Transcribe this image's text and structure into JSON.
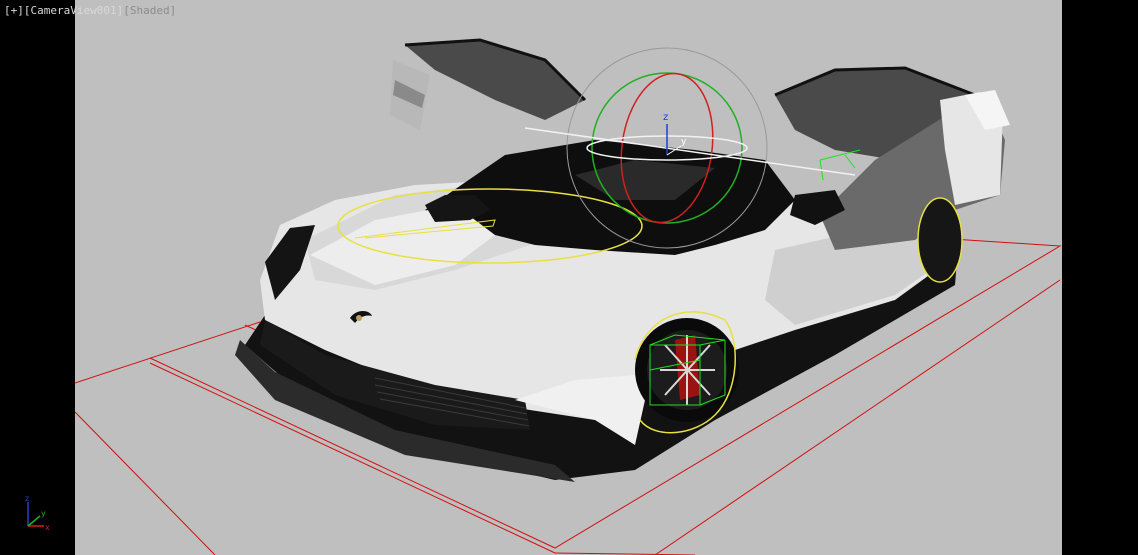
{
  "viewport": {
    "menu_plus": "[+]",
    "camera_label": "[CameraView001]",
    "shading_label": "[Shaded]",
    "name": "CameraView001",
    "shading_mode": "Shaded",
    "background_color": "#bfbfbf",
    "letterbox_color": "#000000"
  },
  "gizmo": {
    "type": "rotate",
    "axis_z_label": "z",
    "axis_y_label": "y",
    "colors": {
      "x_axis": "#d02020",
      "y_axis": "#20b020",
      "z_axis": "#2040d0",
      "screen_ring": "#9a9a9a",
      "selection": "#e8e040"
    }
  },
  "scene": {
    "object": "sports-car",
    "bounding_box_color": "#d01010",
    "wheel_selection_color": "#20e020"
  },
  "axis_tripod": {
    "x_label": "x",
    "y_label": "y",
    "z_label": "z"
  }
}
